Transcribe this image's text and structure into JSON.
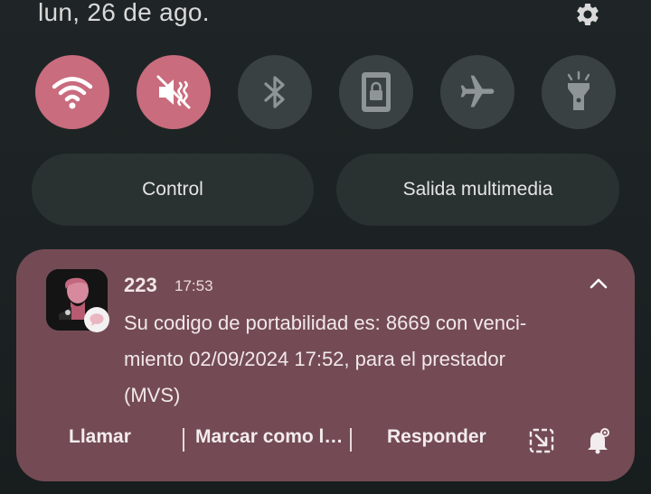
{
  "status": {
    "date": "lun, 26 de ago."
  },
  "quick_tiles": [
    {
      "name": "wifi",
      "active": true
    },
    {
      "name": "sound-mute",
      "active": true
    },
    {
      "name": "bluetooth",
      "active": false
    },
    {
      "name": "rotation-lock",
      "active": false
    },
    {
      "name": "airplane-mode",
      "active": false
    },
    {
      "name": "flashlight",
      "active": false
    }
  ],
  "panels": {
    "control_label": "Control",
    "media_label": "Salida multimedia"
  },
  "notification": {
    "sender": "223",
    "time": "17:53",
    "message_lines": [
      "Su codigo de portabilidad es: 8669 con venci-",
      "miento 02/09/2024 17:52, para el prestador",
      "(MVS)"
    ],
    "actions": {
      "call": "Llamar",
      "mark_read": "Marcar como l…",
      "reply": "Responder"
    }
  },
  "colors": {
    "active_tile": "#c96c7e",
    "inactive_tile": "#3a4142",
    "notification_card": "#744b54",
    "background": "#1f2526"
  }
}
